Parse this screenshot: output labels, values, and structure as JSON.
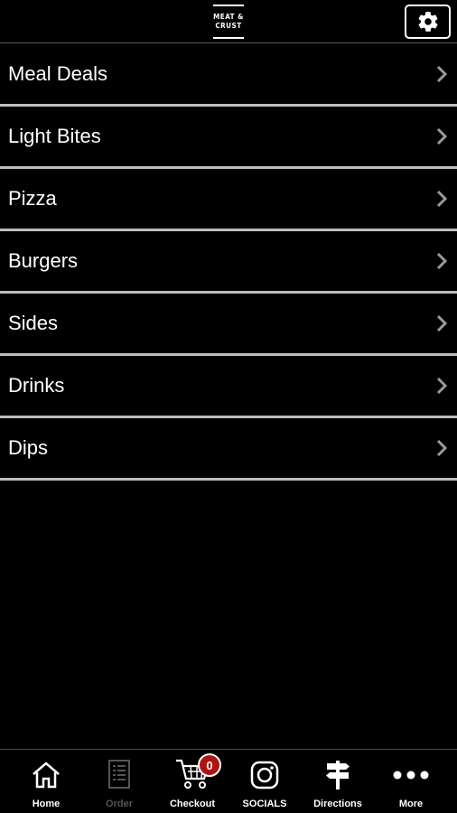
{
  "header": {
    "logo_line1": "MEAT &",
    "logo_line2": "CRUST"
  },
  "menu": {
    "items": [
      {
        "label": "Meal Deals"
      },
      {
        "label": "Light Bites"
      },
      {
        "label": "Pizza"
      },
      {
        "label": "Burgers"
      },
      {
        "label": "Sides"
      },
      {
        "label": "Drinks"
      },
      {
        "label": "Dips"
      }
    ]
  },
  "tabbar": {
    "home": "Home",
    "order": "Order",
    "checkout": "Checkout",
    "cart_count": "0",
    "socials": "SOCIALS",
    "directions": "Directions",
    "more": "More"
  },
  "colors": {
    "background": "#000000",
    "divider": "#bdbdbd",
    "badge": "#b01212"
  }
}
